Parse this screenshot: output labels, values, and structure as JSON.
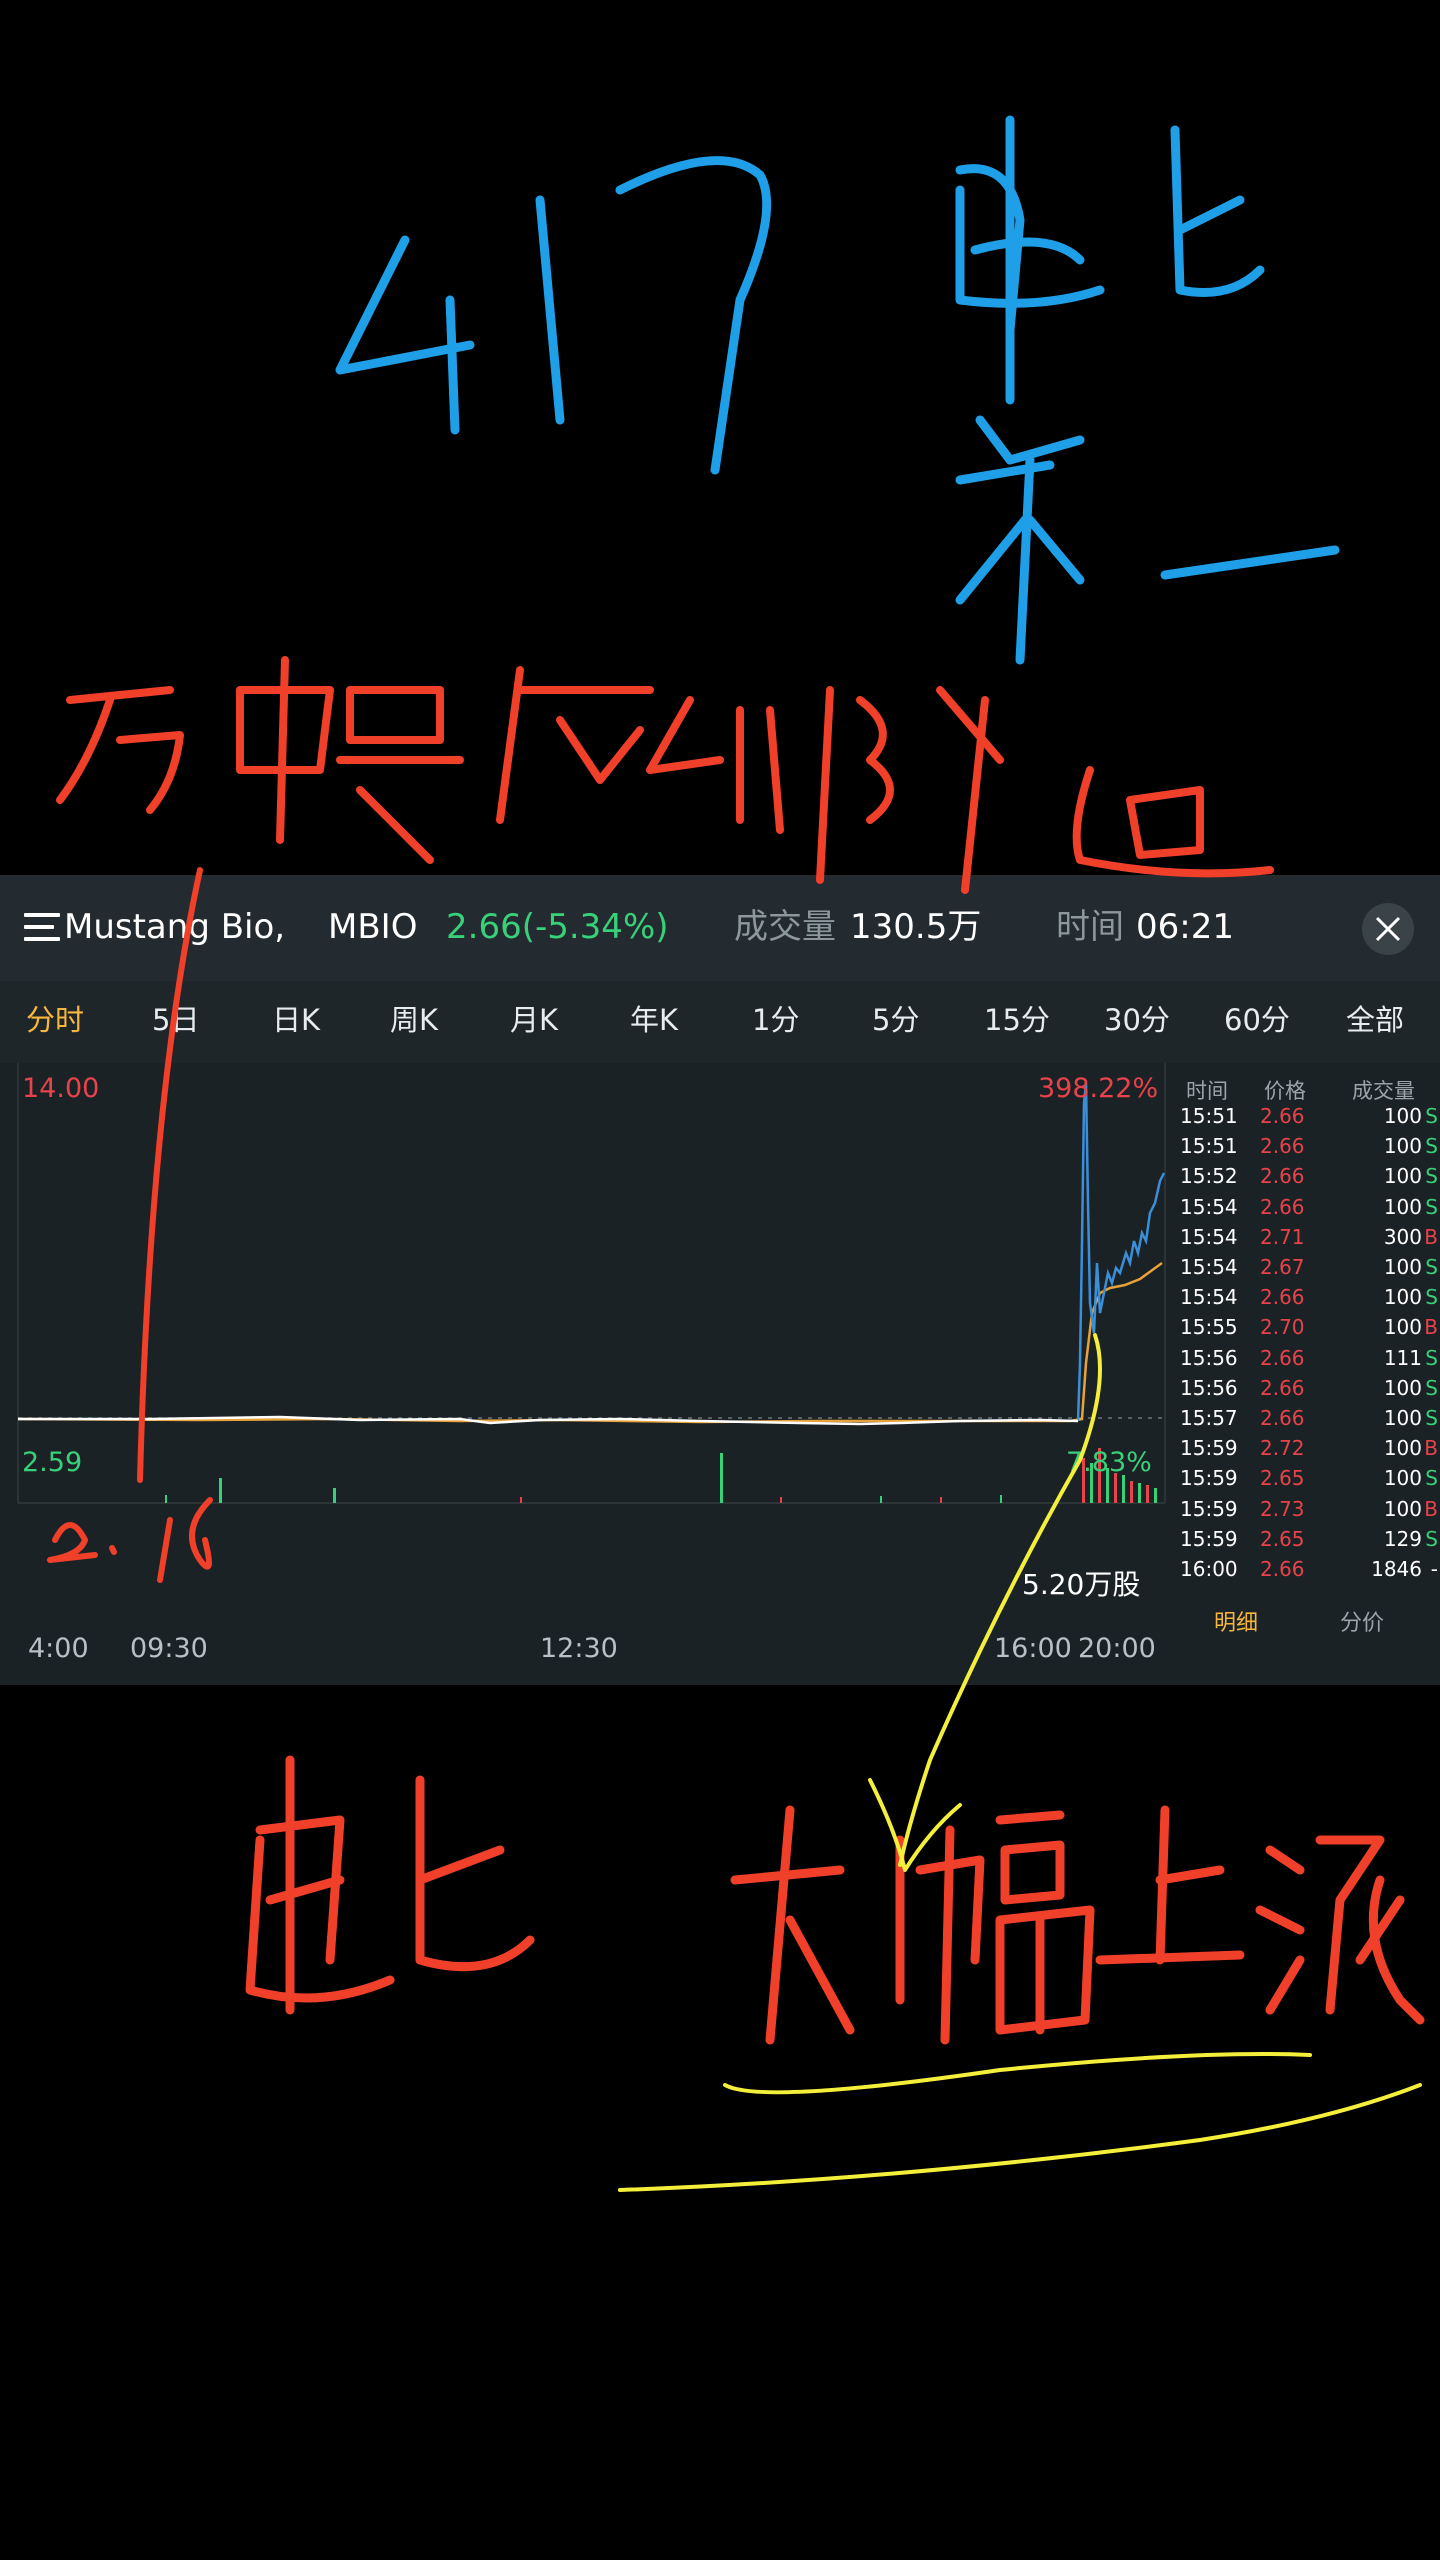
{
  "quote": {
    "name": "Mustang Bio,",
    "symbol": "MBIO",
    "price_change": "2.66(-5.34%)",
    "volume_label": "成交量",
    "volume": "130.5万",
    "time_label": "时间",
    "time": "06:21"
  },
  "tabs": [
    "分时",
    "5日",
    "日K",
    "周K",
    "月K",
    "年K",
    "1分",
    "5分",
    "15分",
    "30分",
    "60分",
    "全部"
  ],
  "chart": {
    "max_price": "14.00",
    "max_pct": "398.22%",
    "prev_close": "2.59",
    "current_pct": "7.83%",
    "volume_readout": "5.20万股",
    "x_labels": [
      "4:00",
      "09:30",
      "12:30",
      "16:00",
      "20:00"
    ]
  },
  "trades": {
    "headers": [
      "时间",
      "价格",
      "成交量"
    ],
    "rows": [
      {
        "time": "15:51",
        "price": "2.66",
        "vol": "100",
        "side": "S"
      },
      {
        "time": "15:51",
        "price": "2.66",
        "vol": "100",
        "side": "S"
      },
      {
        "time": "15:52",
        "price": "2.66",
        "vol": "100",
        "side": "S"
      },
      {
        "time": "15:54",
        "price": "2.66",
        "vol": "100",
        "side": "S"
      },
      {
        "time": "15:54",
        "price": "2.71",
        "vol": "300",
        "side": "B"
      },
      {
        "time": "15:54",
        "price": "2.67",
        "vol": "100",
        "side": "S"
      },
      {
        "time": "15:54",
        "price": "2.66",
        "vol": "100",
        "side": "S"
      },
      {
        "time": "15:55",
        "price": "2.70",
        "vol": "100",
        "side": "B"
      },
      {
        "time": "15:56",
        "price": "2.66",
        "vol": "111",
        "side": "S"
      },
      {
        "time": "15:56",
        "price": "2.66",
        "vol": "100",
        "side": "S"
      },
      {
        "time": "15:57",
        "price": "2.66",
        "vol": "100",
        "side": "S"
      },
      {
        "time": "15:59",
        "price": "2.72",
        "vol": "100",
        "side": "B"
      },
      {
        "time": "15:59",
        "price": "2.65",
        "vol": "100",
        "side": "S"
      },
      {
        "time": "15:59",
        "price": "2.73",
        "vol": "100",
        "side": "B"
      },
      {
        "time": "15:59",
        "price": "2.65",
        "vol": "129",
        "side": "S"
      },
      {
        "time": "16:00",
        "price": "2.66",
        "vol": "1846",
        "side": "-"
      }
    ],
    "tab_detail": "明细",
    "tab_price": "分价"
  },
  "annotations": {
    "top_right": "周二 第一",
    "bottom_right": "大幅上涨",
    "bottom_left": "周二",
    "price_note": "2.18",
    "top": "417",
    "middle": "历史最底价附近"
  },
  "colors": {
    "up": "#e8424a",
    "down": "#39d07a",
    "accent": "#f6b73c",
    "ink_blue": "#1e9fe8",
    "ink_red": "#f0402a",
    "ink_yellow": "#f4ef3a"
  }
}
